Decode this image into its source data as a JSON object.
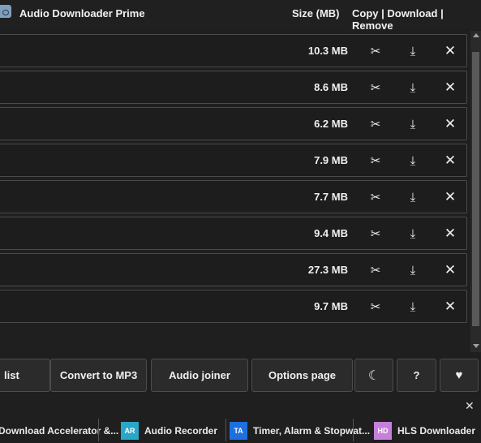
{
  "header": {
    "title": "Audio Downloader Prime",
    "size_col": "Size (MB)",
    "actions_col": "Copy | Download | Remove"
  },
  "rows": [
    {
      "size": "10.3 MB"
    },
    {
      "size": "8.6 MB"
    },
    {
      "size": "6.2 MB"
    },
    {
      "size": "7.9 MB"
    },
    {
      "size": "7.7 MB"
    },
    {
      "size": "9.4 MB"
    },
    {
      "size": "27.3 MB"
    },
    {
      "size": "9.7 MB"
    }
  ],
  "row_icons": {
    "cut": "✂",
    "download": "⤓",
    "remove": "✕"
  },
  "toolbar": {
    "list_label": "list",
    "convert_label": "Convert to MP3",
    "joiner_label": "Audio joiner",
    "options_label": "Options page",
    "theme_icon": "☾",
    "help_label": "?",
    "heart_icon": "♥"
  },
  "promo": {
    "close": "✕",
    "items": [
      {
        "label": "Download Accelerator &...",
        "badge": "",
        "color": ""
      },
      {
        "label": "Audio Recorder",
        "badge": "AR",
        "color": "#2aa6c9"
      },
      {
        "label": "Timer, Alarm & Stopwat...",
        "badge": "TA",
        "color": "#1e6fe0"
      },
      {
        "label": "HLS Downloader",
        "badge": "HD",
        "color": "#c77fdc"
      }
    ]
  }
}
